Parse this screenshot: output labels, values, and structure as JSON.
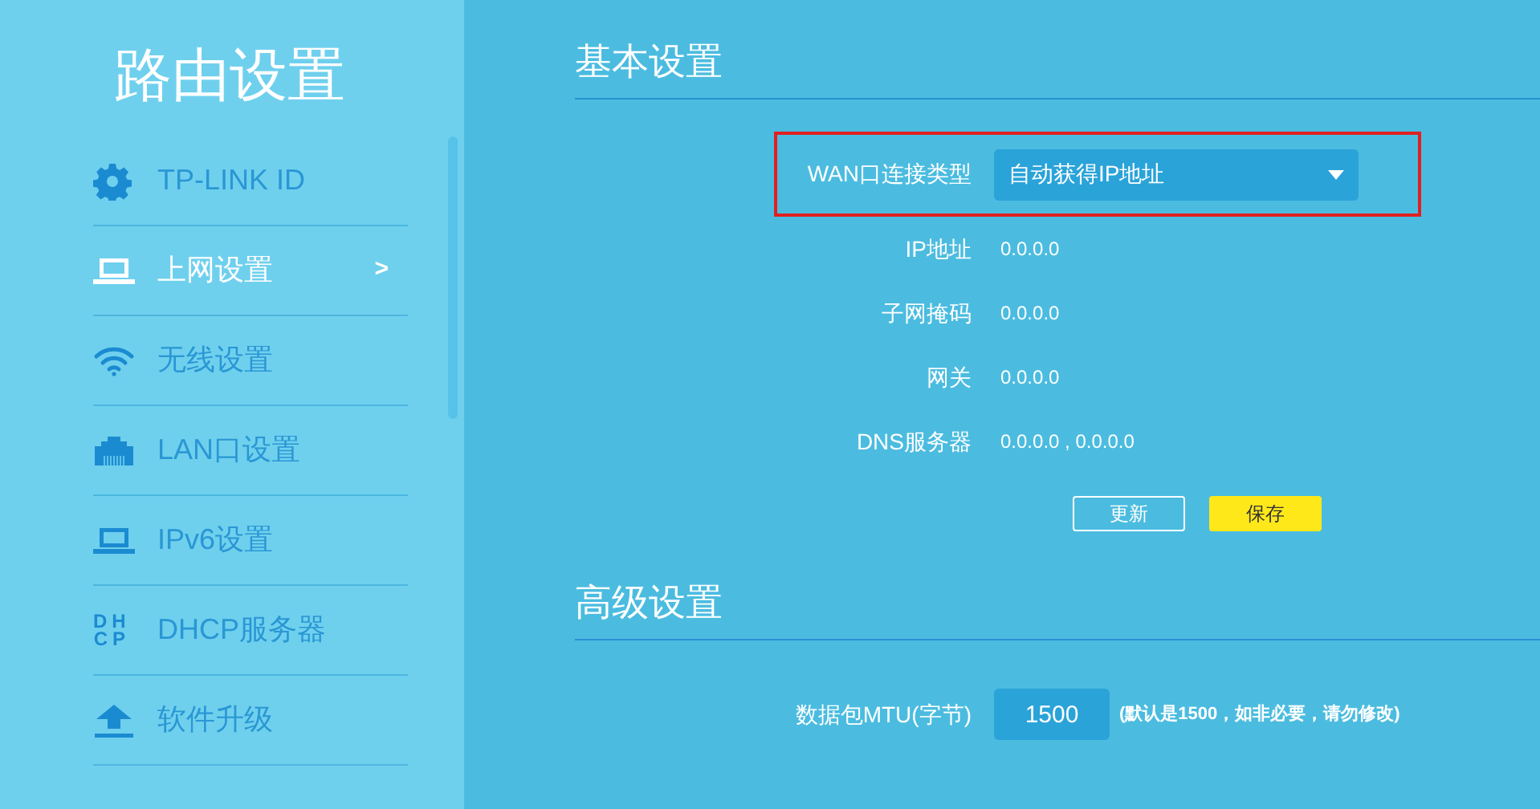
{
  "sidebar": {
    "title": "路由设置",
    "items": [
      {
        "label": "TP-LINK ID",
        "kind": "gear",
        "selected": false
      },
      {
        "label": "上网设置",
        "kind": "laptop",
        "selected": true,
        "arrow": ">"
      },
      {
        "label": "无线设置",
        "kind": "wifi",
        "selected": false
      },
      {
        "label": "LAN口设置",
        "kind": "ethernet",
        "selected": false
      },
      {
        "label": "IPv6设置",
        "kind": "laptop",
        "selected": false
      },
      {
        "label": "DHCP服务器",
        "kind": "letters",
        "icon_text": [
          "DH",
          "CP"
        ],
        "selected": false
      },
      {
        "label": "软件升级",
        "kind": "upload",
        "selected": false
      }
    ]
  },
  "basic": {
    "title": "基本设置",
    "wan_type": {
      "label": "WAN口连接类型",
      "value": "自动获得IP地址"
    },
    "fields": [
      {
        "label": "IP地址",
        "value": "0.0.0.0"
      },
      {
        "label": "子网掩码",
        "value": "0.0.0.0"
      },
      {
        "label": "网关",
        "value": "0.0.0.0"
      },
      {
        "label": "DNS服务器",
        "value": "0.0.0.0 , 0.0.0.0"
      }
    ],
    "buttons": [
      {
        "label": "更新",
        "kind": "outline"
      },
      {
        "label": "保存",
        "kind": "primary"
      }
    ]
  },
  "advanced": {
    "title": "高级设置",
    "mtu": {
      "label": "数据包MTU(字节)",
      "value": "1500",
      "hint": "(默认是1500，如非必要，请勿修改)"
    }
  }
}
